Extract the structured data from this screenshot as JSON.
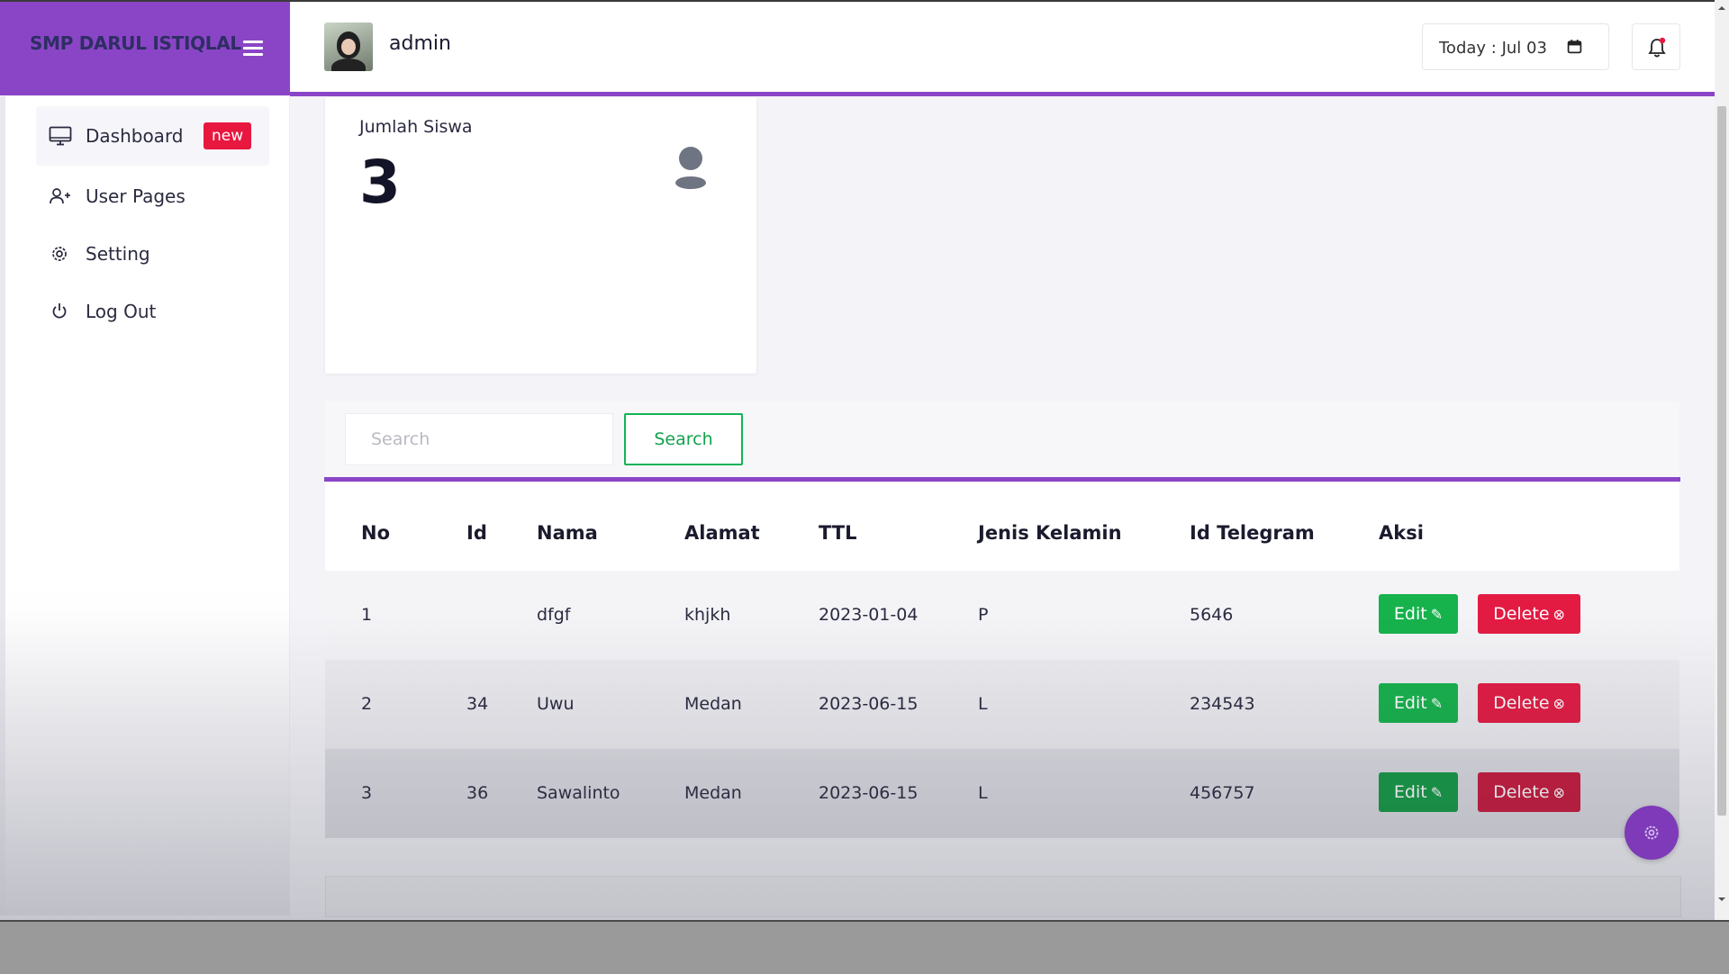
{
  "brand": {
    "title": "SMP DARUL ISTIQLAL"
  },
  "header": {
    "user_name": "admin",
    "today_label": "Today : Jul 03"
  },
  "sidebar": {
    "items": [
      {
        "label": "Dashboard",
        "badge": "new",
        "icon": "monitor-icon"
      },
      {
        "label": "User Pages",
        "icon": "user-plus-icon"
      },
      {
        "label": "Setting",
        "icon": "gear-icon"
      },
      {
        "label": "Log Out",
        "icon": "power-icon"
      }
    ]
  },
  "stat_card": {
    "label": "Jumlah Siswa",
    "value": "3",
    "icon": "user-icon"
  },
  "search": {
    "placeholder": "Search",
    "button_label": "Search"
  },
  "table": {
    "headers": [
      "No",
      "Id",
      "Nama",
      "Alamat",
      "TTL",
      "Jenis Kelamin",
      "Id Telegram",
      "Aksi"
    ],
    "rows": [
      {
        "no": "1",
        "id": "",
        "nama": "dfgf",
        "alamat": "khjkh",
        "ttl": "2023-01-04",
        "jk": "P",
        "telegram": "5646"
      },
      {
        "no": "2",
        "id": "34",
        "nama": "Uwu",
        "alamat": "Medan",
        "ttl": "2023-06-15",
        "jk": "L",
        "telegram": "234543"
      },
      {
        "no": "3",
        "id": "36",
        "nama": "Sawalinto",
        "alamat": "Medan",
        "ttl": "2023-06-15",
        "jk": "L",
        "telegram": "456757"
      }
    ],
    "edit_label": "Edit",
    "delete_label": "Delete"
  },
  "colors": {
    "brand": "#8a45c7",
    "success": "#16b24c",
    "danger": "#e31b43"
  }
}
